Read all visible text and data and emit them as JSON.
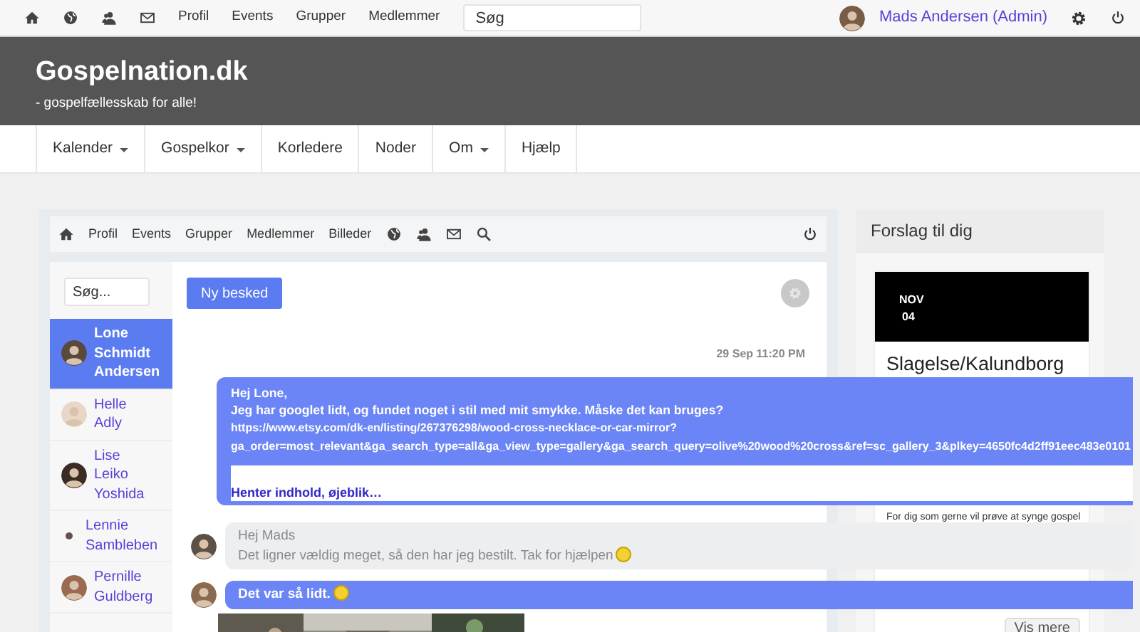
{
  "top_bar": {
    "links": [
      "Profil",
      "Events",
      "Grupper",
      "Medlemmer"
    ],
    "search": {
      "placeholder": "Søg"
    },
    "user": "Mads Andersen (Admin)"
  },
  "header": {
    "title": "Gospelnation.dk",
    "tagline": "- gospelfællesskab for alle!"
  },
  "menu": [
    {
      "label": "Kalender",
      "dropdown": true
    },
    {
      "label": "Gospelkor",
      "dropdown": true
    },
    {
      "label": "Korledere",
      "dropdown": false
    },
    {
      "label": "Noder",
      "dropdown": false
    },
    {
      "label": "Om",
      "dropdown": true
    },
    {
      "label": "Hjælp",
      "dropdown": false
    }
  ],
  "messenger": {
    "nav_links": [
      "Profil",
      "Events",
      "Grupper",
      "Medlemmer",
      "Billeder"
    ],
    "search": {
      "placeholder": "Søg..."
    },
    "new_button": "Ny besked",
    "contacts": [
      {
        "name": "Lone Schmidt Andersen",
        "selected": true,
        "has_photo": true
      },
      {
        "name": "Helle Adly",
        "selected": false,
        "has_photo": true
      },
      {
        "name": "Lise Leiko Yoshida",
        "selected": false,
        "has_photo": true
      },
      {
        "name": "Lennie Sambleben",
        "selected": false,
        "has_photo": false
      },
      {
        "name": "Pernille Guldberg",
        "selected": false,
        "has_photo": true
      }
    ],
    "date": "29 Sep 11:20 PM",
    "messages": [
      {
        "kind": "sent",
        "lines": [
          "Hej Lone,",
          "Jeg har googlet lidt, og fundet noget i stil med mit smykke. Måske det kan bruges?"
        ],
        "link_lines": [
          "https://www.etsy.com/dk-en/listing/267376298/wood-cross-necklace-or-car-mirror?",
          "ga_order=most_relevant&ga_search_type=all&ga_view_type=gallery&ga_search_query=olive%20wood%20cross&ref=sc_gallery_3&plkey=4650fc4d2ff91eec483e0101"
        ],
        "loading": "Henter indhold, øjeblik…"
      },
      {
        "kind": "received",
        "lines": [
          "Hej Mads",
          "Det ligner vældig meget, så den har jeg bestilt. Tak for hjælpen"
        ],
        "emoji": true
      },
      {
        "kind": "reply",
        "lines": [
          "Det var så lidt."
        ],
        "emoji": true
      },
      {
        "kind": "picture"
      }
    ]
  },
  "suggestions": {
    "title": "Forslag til dig",
    "event": {
      "month": "NOV",
      "day": "04",
      "title": "Slagelse/Kalundborg",
      "description": "For dig som gerne vil prøve at synge gospel"
    },
    "button": "Vis mere"
  }
}
